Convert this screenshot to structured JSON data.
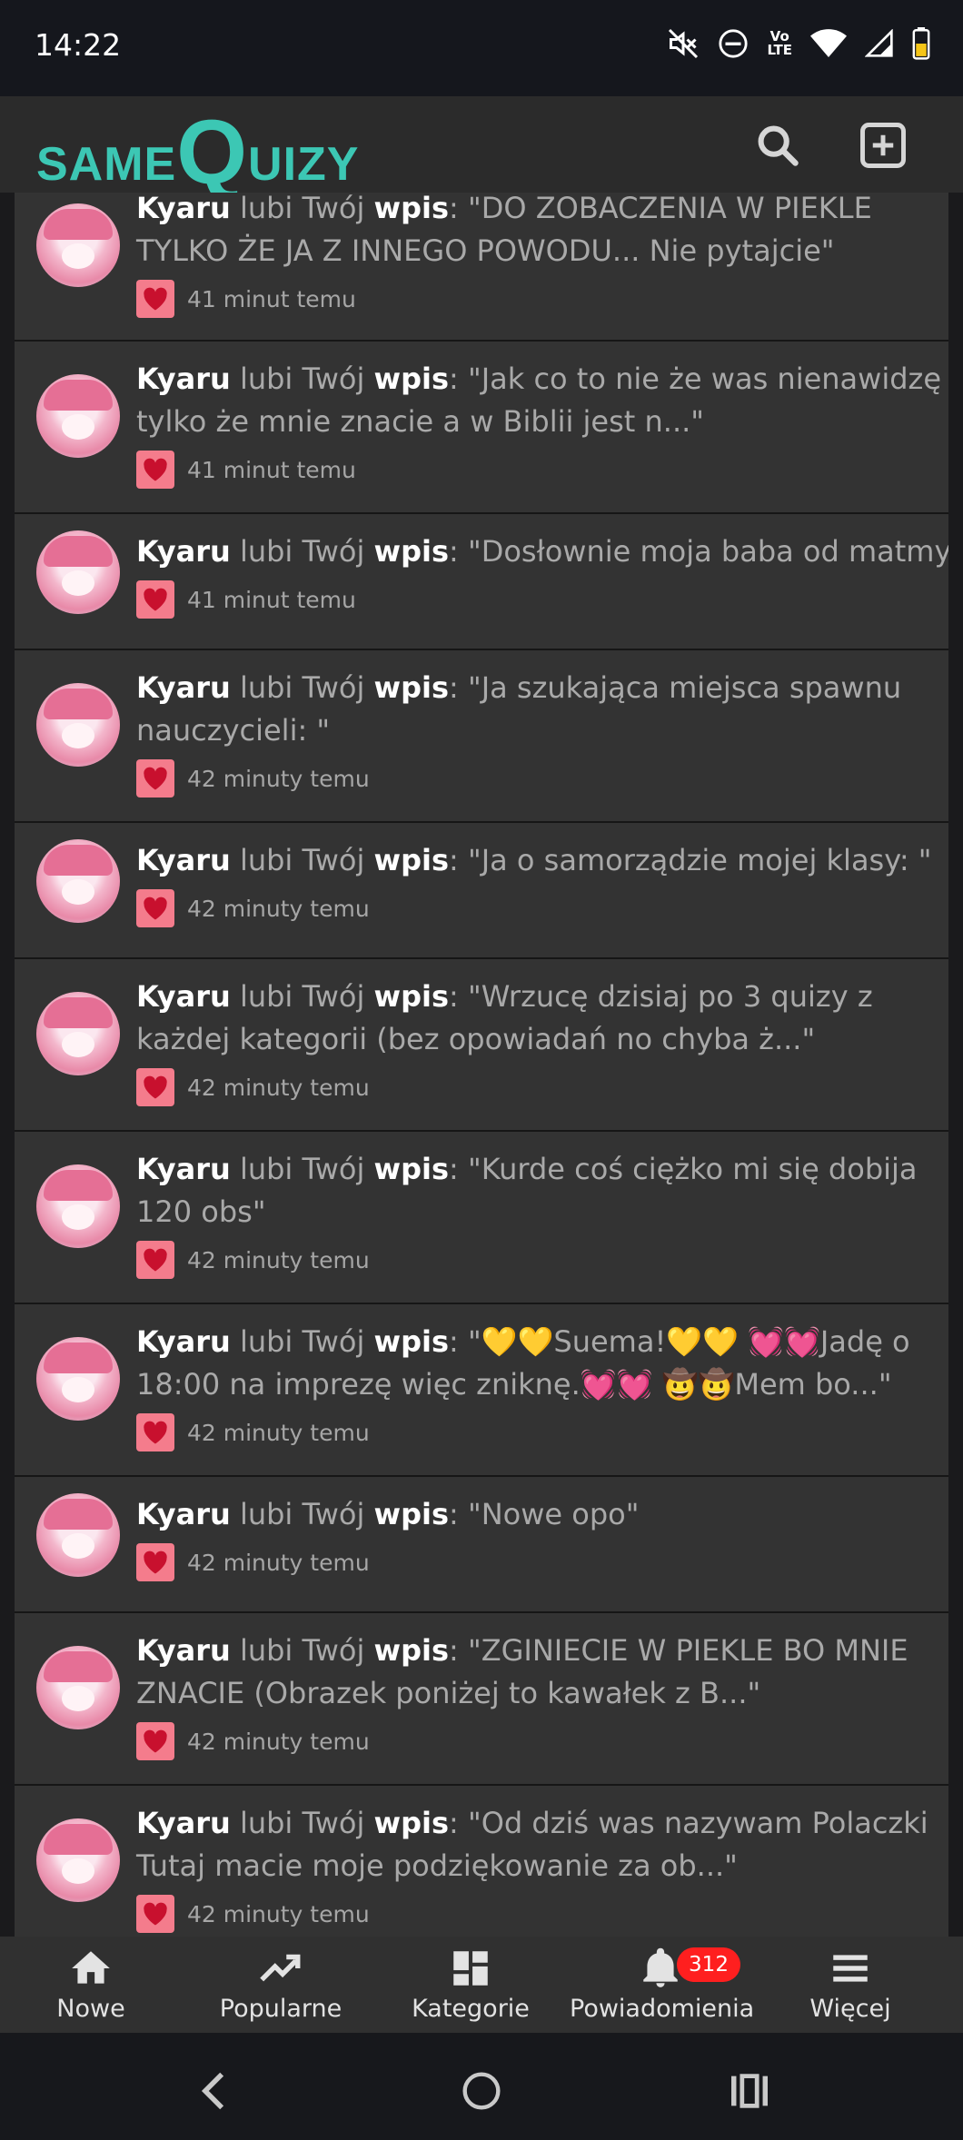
{
  "status_bar": {
    "time": "14:22",
    "lte_label_top": "Vo",
    "lte_label_bottom": "LTE"
  },
  "header": {
    "logo_part1": "SAME",
    "logo_part2": "Q",
    "logo_part3": "UIZY",
    "search_icon": "search-icon",
    "add_icon": "plus-square-icon"
  },
  "notifications": [
    {
      "user": "Kyaru",
      "action": "lubi Twój",
      "object": "wpis",
      "quote": ": \"DO ZOBACZENIA W PIEKLE TYLKO ŻE JA Z INNEGO POWODU... Nie pytajcie\"",
      "time": "41 minut temu"
    },
    {
      "user": "Kyaru",
      "action": "lubi Twój",
      "object": "wpis",
      "quote": ": \"Jak co to nie że was nienawidzę tylko że mnie znacie a w Biblii jest n...\"",
      "time": "41 minut temu"
    },
    {
      "user": "Kyaru",
      "action": "lubi Twój",
      "object": "wpis",
      "quote": ": \"Dosłownie moja baba od matmy \"",
      "time": "41 minut temu"
    },
    {
      "user": "Kyaru",
      "action": "lubi Twój",
      "object": "wpis",
      "quote": ": \"Ja szukająca miejsca spawnu nauczycieli: \"",
      "time": "42 minuty temu"
    },
    {
      "user": "Kyaru",
      "action": "lubi Twój",
      "object": "wpis",
      "quote": ": \"Ja o samorządzie mojej klasy: \"",
      "time": "42 minuty temu"
    },
    {
      "user": "Kyaru",
      "action": "lubi Twój",
      "object": "wpis",
      "quote": ": \"Wrzucę dzisiaj po 3 quizy z każdej kategorii (bez opowiadań no chyba ż...\"",
      "time": "42 minuty temu"
    },
    {
      "user": "Kyaru",
      "action": "lubi Twój",
      "object": "wpis",
      "quote": ": \"Kurde coś ciężko mi się dobija 120 obs\"",
      "time": "42 minuty temu"
    },
    {
      "user": "Kyaru",
      "action": "lubi Twój",
      "object": "wpis",
      "quote": ": \"💛💛Suema!💛💛 💓💓Jadę o 18:00 na imprezę więc zniknę.💓💓 🤠🤠Mem bo...\"",
      "time": "42 minuty temu"
    },
    {
      "user": "Kyaru",
      "action": "lubi Twój",
      "object": "wpis",
      "quote": ": \"Nowe opo\"",
      "time": "42 minuty temu"
    },
    {
      "user": "Kyaru",
      "action": "lubi Twój",
      "object": "wpis",
      "quote": ": \"ZGINIECIE W PIEKLE BO MNIE ZNACIE (Obrazek poniżej to kawałek z B...\"",
      "time": "42 minuty temu"
    },
    {
      "user": "Kyaru",
      "action": "lubi Twój",
      "object": "wpis",
      "quote": ": \"Od dziś was nazywam Polaczki Tutaj macie moje podziękowanie za ob...\"",
      "time": "42 minuty temu"
    }
  ],
  "bottom_nav": {
    "items": [
      {
        "label": "Nowe",
        "icon": "home-icon"
      },
      {
        "label": "Popularne",
        "icon": "trending-icon"
      },
      {
        "label": "Kategorie",
        "icon": "dashboard-icon"
      },
      {
        "label": "Powiadomienia",
        "icon": "bell-icon",
        "badge": "312"
      },
      {
        "label": "Więcej",
        "icon": "menu-icon"
      }
    ]
  },
  "colors": {
    "brand": "#3cc7b4",
    "card": "#333333",
    "heart": "#f47c8c",
    "badge": "#ff1f1f"
  }
}
